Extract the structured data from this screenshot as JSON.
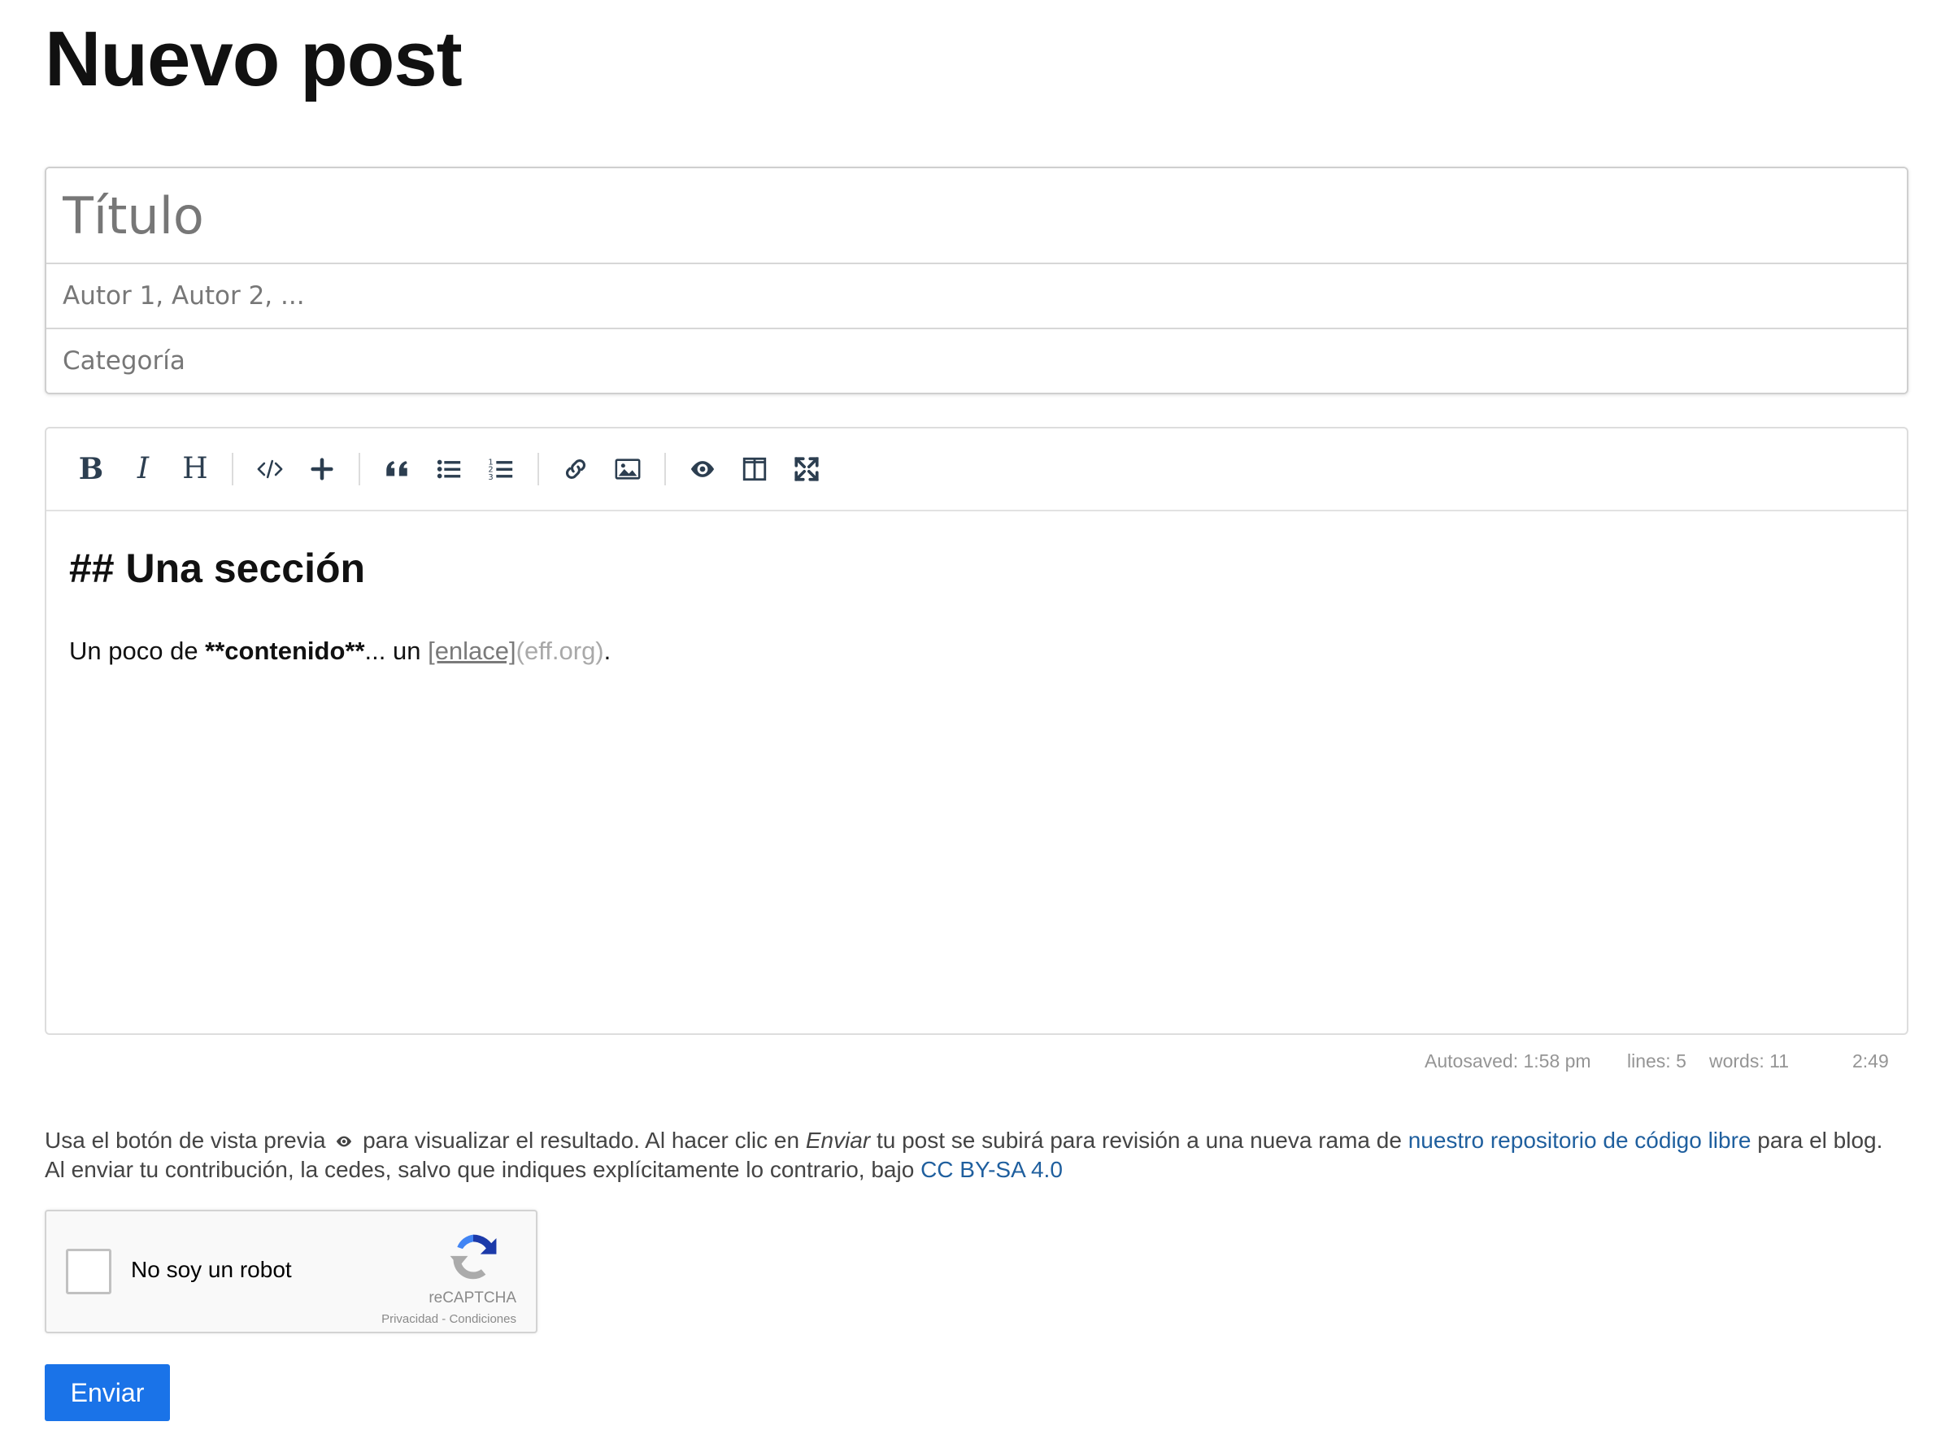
{
  "page": {
    "title": "Nuevo post"
  },
  "form": {
    "title_placeholder": "Título",
    "author_placeholder": "Autor 1, Autor 2, ...",
    "category_placeholder": "Categoría"
  },
  "toolbar": {
    "groups": [
      [
        "bold-icon",
        "italic-icon",
        "heading-icon"
      ],
      [
        "code-icon",
        "plus-icon"
      ],
      [
        "quote-icon",
        "unordered-list-icon",
        "ordered-list-icon"
      ],
      [
        "link-icon",
        "image-icon"
      ],
      [
        "preview-eye-icon",
        "side-by-side-icon",
        "fullscreen-icon"
      ]
    ],
    "bold_label": "B",
    "italic_label": "I",
    "heading_label": "H"
  },
  "editor": {
    "heading": "## Una sección",
    "para_prefix": "Un poco de ",
    "para_bold": "**contenido**",
    "para_middle": "... un ",
    "para_link_text": "[enlace]",
    "para_link_url": "(eff.org)",
    "para_suffix": "."
  },
  "statusbar": {
    "autosaved": "Autosaved: 1:58 pm",
    "lines": "lines: 5",
    "words": "words: 11",
    "cursor": "2:49"
  },
  "note": {
    "part1": "Usa el botón de vista previa ",
    "part2": " para visualizar el resultado. Al hacer clic en ",
    "enviar_italic": "Enviar",
    "part3": " tu post se subirá para revisión a una nueva rama de ",
    "repo_link": "nuestro repositorio de código libre",
    "part4": " para el blog.",
    "part5": "Al enviar tu contribución, la cedes, salvo que indiques explícitamente lo contrario, bajo ",
    "license_link": "CC BY-SA 4.0"
  },
  "captcha": {
    "label": "No soy un robot",
    "brand": "reCAPTCHA",
    "links": "Privacidad - Condiciones"
  },
  "submit": {
    "label": "Enviar"
  },
  "colors": {
    "accent": "#1a73e8",
    "link": "#1f5f9e"
  }
}
